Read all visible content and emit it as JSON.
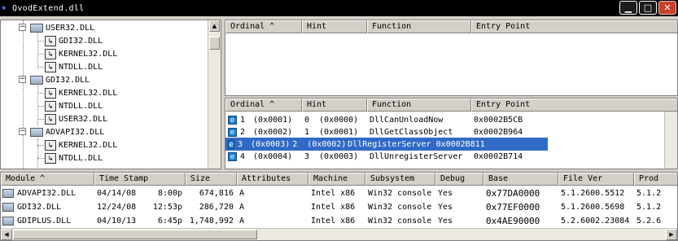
{
  "window": {
    "title": "QvodExtend.dll",
    "buttons": {
      "minimize": "▁",
      "maximize": "□",
      "close": "✕"
    }
  },
  "tree": {
    "items": [
      {
        "label": "USER32.DLL",
        "level": 0,
        "icon": "module-icon",
        "expanded": true
      },
      {
        "label": "GDI32.DLL",
        "level": 1,
        "icon": "import-module-icon"
      },
      {
        "label": "KERNEL32.DLL",
        "level": 1,
        "icon": "import-module-icon"
      },
      {
        "label": "NTDLL.DLL",
        "level": 1,
        "icon": "import-module-icon"
      },
      {
        "label": "GDI32.DLL",
        "level": 0,
        "icon": "module-icon",
        "expanded": true
      },
      {
        "label": "KERNEL32.DLL",
        "level": 1,
        "icon": "import-module-icon"
      },
      {
        "label": "NTDLL.DLL",
        "level": 1,
        "icon": "import-module-icon"
      },
      {
        "label": "USER32.DLL",
        "level": 1,
        "icon": "import-module-icon"
      },
      {
        "label": "ADVAPI32.DLL",
        "level": 0,
        "icon": "module-icon",
        "expanded": true
      },
      {
        "label": "KERNEL32.DLL",
        "level": 1,
        "icon": "import-module-icon"
      },
      {
        "label": "NTDLL.DLL",
        "level": 1,
        "icon": "import-module-icon"
      }
    ]
  },
  "imports": {
    "columns": [
      "Ordinal ^",
      "Hint",
      "Function",
      "Entry Point"
    ]
  },
  "exports": {
    "columns": [
      "Ordinal ^",
      "Hint",
      "Function",
      "Entry Point"
    ],
    "rows": [
      {
        "ord": "1",
        "ordhex": "(0x0001)",
        "hint": "0",
        "hinthex": "(0x0000)",
        "func": "DllCanUnloadNow",
        "entry": "0x0002B5CB",
        "selected": false
      },
      {
        "ord": "2",
        "ordhex": "(0x0002)",
        "hint": "1",
        "hinthex": "(0x0001)",
        "func": "DllGetClassObject",
        "entry": "0x0002B964",
        "selected": false
      },
      {
        "ord": "3",
        "ordhex": "(0x0003)",
        "hint": "2",
        "hinthex": "(0x0002)",
        "func": "DllRegisterServer",
        "entry": "0x0002B811",
        "selected": true
      },
      {
        "ord": "4",
        "ordhex": "(0x0004)",
        "hint": "3",
        "hinthex": "(0x0003)",
        "func": "DllUnregisterServer",
        "entry": "0x0002B714",
        "selected": false
      }
    ]
  },
  "modules": {
    "columns": [
      "Module ^",
      "Time Stamp",
      "Size",
      "Attributes",
      "Machine",
      "Subsystem",
      "Debug",
      "Base",
      "File Ver",
      "Prod"
    ],
    "rows": [
      {
        "module": "ADVAPI32.DLL",
        "date": "04/14/08",
        "time": "8:00p",
        "size": "674,816",
        "attr": "A",
        "machine": "Intel x86",
        "subsystem": "Win32 console",
        "debug": "Yes",
        "base": "0x77DA0000",
        "filever": "5.1.2600.5512",
        "prod": "5.1.2"
      },
      {
        "module": "GDI32.DLL",
        "date": "12/24/08",
        "time": "12:53p",
        "size": "286,720",
        "attr": "A",
        "machine": "Intel x86",
        "subsystem": "Win32 console",
        "debug": "Yes",
        "base": "0x77EF0000",
        "filever": "5.1.2600.5698",
        "prod": "5.1.2"
      },
      {
        "module": "GDIPLUS.DLL",
        "date": "04/10/13",
        "time": "6:45p",
        "size": "1,748,992",
        "attr": "A",
        "machine": "Intel x86",
        "subsystem": "Win32 console",
        "debug": "Yes",
        "base": "0x4AE90000",
        "filever": "5.2.6002.23084",
        "prod": "5.2.6"
      }
    ]
  },
  "colors": {
    "selection": "#316ac5",
    "titlebar": "#000000",
    "face": "#d4d0c8"
  }
}
